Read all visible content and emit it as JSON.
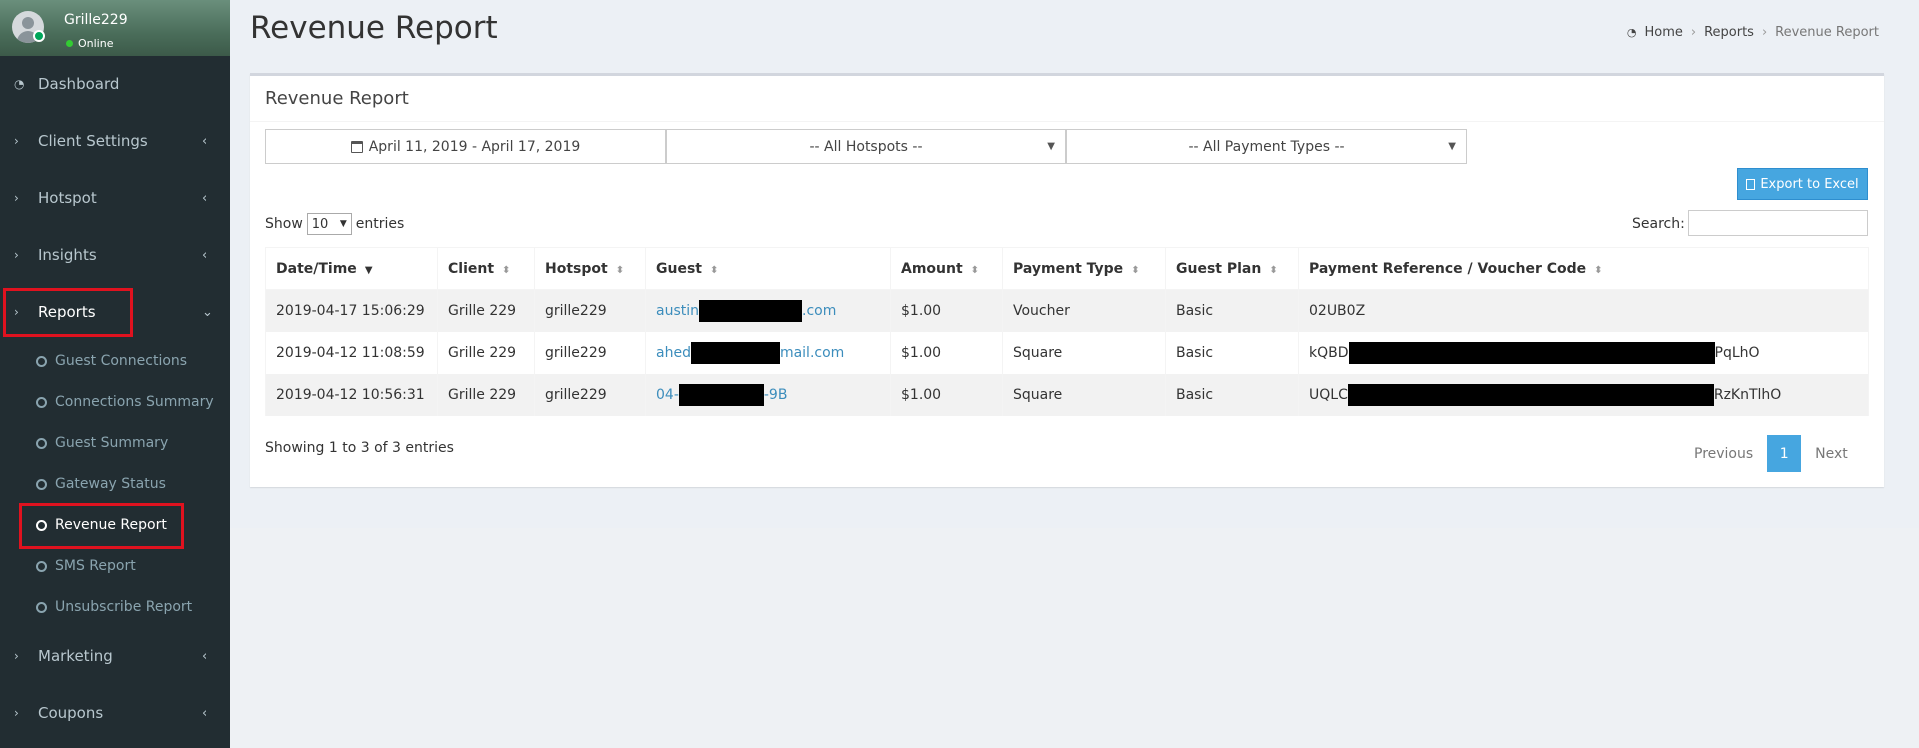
{
  "user": {
    "name": "Grille229",
    "status": "Online"
  },
  "sidebar": {
    "items": [
      {
        "label": "Dashboard",
        "icon": "dashboard-icon"
      },
      {
        "label": "Client Settings",
        "icon": "chevron-right-icon"
      },
      {
        "label": "Hotspot",
        "icon": "chevron-right-icon"
      },
      {
        "label": "Insights",
        "icon": "chevron-right-icon"
      },
      {
        "label": "Reports",
        "icon": "chevron-right-icon"
      },
      {
        "label": "Marketing",
        "icon": "chevron-right-icon"
      },
      {
        "label": "Coupons",
        "icon": "chevron-right-icon"
      }
    ],
    "sub_items": [
      {
        "label": "Guest Connections"
      },
      {
        "label": "Connections Summary"
      },
      {
        "label": "Guest Summary"
      },
      {
        "label": "Gateway Status"
      },
      {
        "label": "Revenue Report"
      },
      {
        "label": "SMS Report"
      },
      {
        "label": "Unsubscribe Report"
      }
    ]
  },
  "header": {
    "title": "Revenue Report",
    "breadcrumb": [
      "Home",
      "Reports",
      "Revenue Report"
    ]
  },
  "box": {
    "title": "Revenue Report",
    "date_range": "April 11, 2019 - April 17, 2019",
    "hotspot_filter": "-- All Hotspots --",
    "payment_filter": "-- All Payment Types --",
    "export_label": "Export to Excel",
    "show_label": "Show",
    "entries_label": "entries",
    "page_length": "10",
    "search_label": "Search:"
  },
  "table": {
    "columns": [
      "Date/Time",
      "Client",
      "Hotspot",
      "Guest",
      "Amount",
      "Payment Type",
      "Guest Plan",
      "Payment Reference / Voucher Code"
    ],
    "rows": [
      {
        "datetime": "2019-04-17 15:06:29",
        "client": "Grille 229",
        "hotspot": "grille229",
        "guest_prefix": "austin",
        "guest_suffix": ".com",
        "amount": "$1.00",
        "payment_type": "Voucher",
        "plan": "Basic",
        "ref_prefix": "02UB0Z",
        "ref_suffix": ""
      },
      {
        "datetime": "2019-04-12 11:08:59",
        "client": "Grille 229",
        "hotspot": "grille229",
        "guest_prefix": "ahed",
        "guest_suffix": "mail.com",
        "amount": "$1.00",
        "payment_type": "Square",
        "plan": "Basic",
        "ref_prefix": "kQBD",
        "ref_suffix": "PqLhO"
      },
      {
        "datetime": "2019-04-12 10:56:31",
        "client": "Grille 229",
        "hotspot": "grille229",
        "guest_prefix": "04-",
        "guest_suffix": "-9B",
        "amount": "$1.00",
        "payment_type": "Square",
        "plan": "Basic",
        "ref_prefix": "UQLC",
        "ref_suffix": "RzKnTlhO"
      }
    ]
  },
  "footer": {
    "info": "Showing 1 to 3 of 3 entries",
    "prev": "Previous",
    "page": "1",
    "next": "Next"
  }
}
